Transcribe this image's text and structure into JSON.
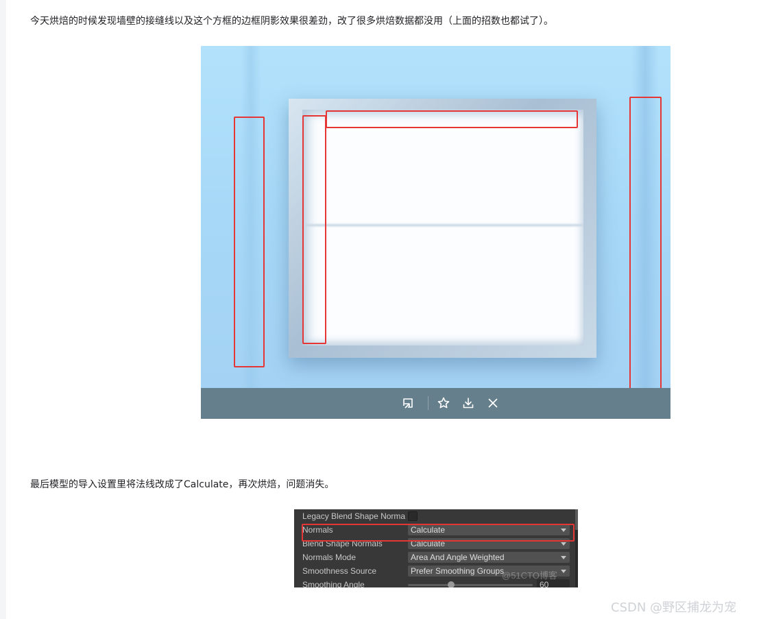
{
  "article": {
    "paragraph1": "今天烘焙的时候发现墙壁的接缝线以及这个方框的边框阴影效果很差劲，改了很多烘焙数据都没用（上面的招数也都试了）。",
    "paragraph2": "最后模型的导入设置里将法线改成了Calculate，再次烘焙，问题消失。"
  },
  "image_viewer": {
    "toolbar": [
      "open-original-icon",
      "favorite-star-icon",
      "download-icon",
      "close-icon"
    ]
  },
  "inspector": {
    "rows": [
      {
        "label": "Legacy Blend Shape Norma",
        "control": "checkbox"
      },
      {
        "label": "Normals",
        "value": "Calculate"
      },
      {
        "label": "Blend Shape Normals",
        "value": "Calculate"
      },
      {
        "label": "Normals Mode",
        "value": "Area And Angle Weighted"
      },
      {
        "label": "Smoothness Source",
        "value": "Prefer Smoothing Groups"
      },
      {
        "label": "Smoothing Angle",
        "value": "60"
      }
    ],
    "watermark": "@51CTO博客"
  },
  "page_watermark": "CSDN @野区捕龙为宠",
  "colors": {
    "highlight_red": "#e53535",
    "toolbar_bg": "#65808c",
    "inspector_bg": "#383838"
  }
}
